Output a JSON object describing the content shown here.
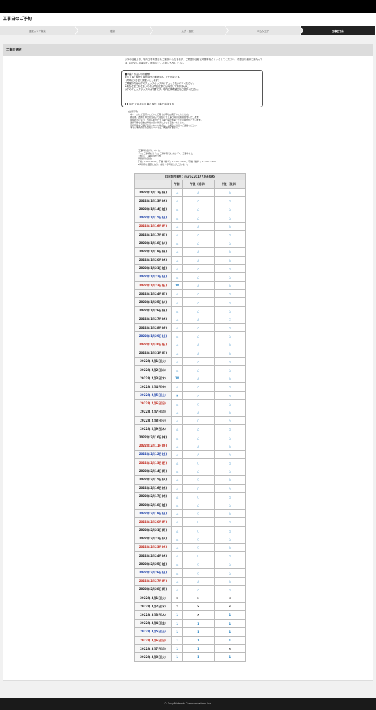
{
  "page_title": "工事日のご予約",
  "steps": [
    {
      "label": "選択カリア検索",
      "active": false
    },
    {
      "label": "確認",
      "active": false
    },
    {
      "label": "入力・選択",
      "active": false
    },
    {
      "label": "申込み完了",
      "active": false
    },
    {
      "label": "工事日予約",
      "active": true
    }
  ],
  "panel": {
    "title": "工事日選択",
    "intro": "以下の日程より、宅内工事希望日をご選択いただきます。ご希望の日程と時間帯をクリックしてください。希望日の選択にあたっては、以下の注意事項をご確認の上、お申し込みください。",
    "notebox": {
      "heading": "■戸建・お住いのお客様",
      "lines": [
        "宅内工事・屋外工事を同日で実施することも可能です。",
        "（同時に2日程を調整いたします）",
        "ご希望の方は以下のチェックボックスにチェックを入れてください。",
        "※集合住宅にお住まいの方は同日工事には対応しておりません。",
        "以下のチェックボックスは不要です。宅内工事希望日をご選択ください。"
      ],
      "checkbox_label": "同日での宅内工事・屋外工事を希望する"
    },
    "notes_title": "[注意事項]",
    "notes": [
      "・本ページにて選択いただいた日程でお申込は完了いたしません。",
      "・確定後、改めて弊社担当者より電話にて工事日時の最終確認をいたします。",
      "・申請状況により、お申込希望日で工事日程が確保できない場合がございます。",
      "・選択可能な日数は弊社の空き状況によって変動いたします。",
      "・選択可能な日程が表示されない場合は、お問合せ窓口へご連絡ください。",
      "・すでに予約済みの日程については、再選択不要です。"
    ],
    "legend_title": "[工事枠の表示について]",
    "legend_lines": [
      "「○」工事枠あり「△」工事枠残りわずか「×」工事枠なし",
      "「数字」工事枠の残り数",
      "[時間帯の目安]",
      "午前：9:00〜12:00、午後（前半）：12:00〜15:00、午後（後半）：15:00〜17:00",
      "※時間帯は目安となり、前後する可能性がございます。"
    ]
  },
  "calendar": {
    "id_label": "ISP契約番号：nuro220177366095",
    "columns": [
      "",
      "午前",
      "午後（前半）",
      "午後（後半）"
    ],
    "rows": [
      {
        "date": "2022年 1月12日(水)",
        "day": "weekday",
        "am": "△",
        "pm1": "△",
        "pm2": "△"
      },
      {
        "date": "2022年 1月13日(木)",
        "day": "weekday",
        "am": "△",
        "pm1": "△",
        "pm2": "△"
      },
      {
        "date": "2022年 1月14日(金)",
        "day": "weekday",
        "am": "△",
        "pm1": "△",
        "pm2": "△"
      },
      {
        "date": "2022年 1月15日(土)",
        "day": "sat",
        "am": "△",
        "pm1": "△",
        "pm2": "△"
      },
      {
        "date": "2022年 1月16日(日)",
        "day": "sun",
        "am": "△",
        "pm1": "△",
        "pm2": "△"
      },
      {
        "date": "2022年 1月17日(月)",
        "day": "weekday",
        "am": "△",
        "pm1": "△",
        "pm2": "△"
      },
      {
        "date": "2022年 1月18日(火)",
        "day": "weekday",
        "am": "△",
        "pm1": "△",
        "pm2": "△"
      },
      {
        "date": "2022年 1月19日(水)",
        "day": "weekday",
        "am": "△",
        "pm1": "△",
        "pm2": "△"
      },
      {
        "date": "2022年 1月20日(木)",
        "day": "weekday",
        "am": "△",
        "pm1": "△",
        "pm2": "△"
      },
      {
        "date": "2022年 1月21日(金)",
        "day": "weekday",
        "am": "△",
        "pm1": "△",
        "pm2": "△"
      },
      {
        "date": "2022年 1月22日(土)",
        "day": "sat",
        "am": "△",
        "pm1": "△",
        "pm2": "△"
      },
      {
        "date": "2022年 1月23日(日)",
        "day": "sun",
        "am": "10",
        "pm1": "△",
        "pm2": "△"
      },
      {
        "date": "2022年 1月24日(月)",
        "day": "weekday",
        "am": "△",
        "pm1": "△",
        "pm2": "△"
      },
      {
        "date": "2022年 1月25日(火)",
        "day": "weekday",
        "am": "△",
        "pm1": "△",
        "pm2": "△"
      },
      {
        "date": "2022年 1月26日(水)",
        "day": "weekday",
        "am": "△",
        "pm1": "△",
        "pm2": "△"
      },
      {
        "date": "2022年 1月27日(木)",
        "day": "weekday",
        "am": "△",
        "pm1": "△",
        "pm2": "○"
      },
      {
        "date": "2022年 1月28日(金)",
        "day": "weekday",
        "am": "△",
        "pm1": "△",
        "pm2": "△"
      },
      {
        "date": "2022年 1月29日(土)",
        "day": "sat",
        "am": "△",
        "pm1": "△",
        "pm2": "△"
      },
      {
        "date": "2022年 1月30日(日)",
        "day": "sun",
        "am": "△",
        "pm1": "△",
        "pm2": "△"
      },
      {
        "date": "2022年 1月31日(月)",
        "day": "weekday",
        "am": "△",
        "pm1": "△",
        "pm2": "△"
      },
      {
        "date": "2022年 2月1日(火)",
        "day": "weekday",
        "am": "△",
        "pm1": "△",
        "pm2": "△"
      },
      {
        "date": "2022年 2月2日(水)",
        "day": "weekday",
        "am": "△",
        "pm1": "△",
        "pm2": "△"
      },
      {
        "date": "2022年 2月3日(木)",
        "day": "weekday",
        "am": "10",
        "pm1": "△",
        "pm2": "△"
      },
      {
        "date": "2022年 2月4日(金)",
        "day": "weekday",
        "am": "△",
        "pm1": "△",
        "pm2": "△"
      },
      {
        "date": "2022年 2月5日(土)",
        "day": "sat",
        "am": "9",
        "pm1": "△",
        "pm2": "△"
      },
      {
        "date": "2022年 2月6日(日)",
        "day": "sun",
        "am": "△",
        "pm1": "○",
        "pm2": "△"
      },
      {
        "date": "2022年 2月7日(月)",
        "day": "weekday",
        "am": "△",
        "pm1": "△",
        "pm2": "△"
      },
      {
        "date": "2022年 2月8日(火)",
        "day": "weekday",
        "am": "△",
        "pm1": "○",
        "pm2": "△"
      },
      {
        "date": "2022年 2月9日(水)",
        "day": "weekday",
        "am": "△",
        "pm1": "△",
        "pm2": "△"
      },
      {
        "date": "2022年 2月10日(木)",
        "day": "weekday",
        "am": "△",
        "pm1": "△",
        "pm2": "△"
      },
      {
        "date": "2022年 2月11日(金)",
        "day": "sun",
        "am": "△",
        "pm1": "△",
        "pm2": "△"
      },
      {
        "date": "2022年 2月12日(土)",
        "day": "sat",
        "am": "△",
        "pm1": "△",
        "pm2": "△"
      },
      {
        "date": "2022年 2月13日(日)",
        "day": "sun",
        "am": "△",
        "pm1": "○",
        "pm2": "△"
      },
      {
        "date": "2022年 2月14日(月)",
        "day": "weekday",
        "am": "△",
        "pm1": "△",
        "pm2": "△"
      },
      {
        "date": "2022年 2月15日(火)",
        "day": "weekday",
        "am": "△",
        "pm1": "○",
        "pm2": "△"
      },
      {
        "date": "2022年 2月16日(水)",
        "day": "weekday",
        "am": "△",
        "pm1": "○",
        "pm2": "△"
      },
      {
        "date": "2022年 2月17日(木)",
        "day": "weekday",
        "am": "△",
        "pm1": "○",
        "pm2": "△"
      },
      {
        "date": "2022年 2月18日(金)",
        "day": "weekday",
        "am": "△",
        "pm1": "△",
        "pm2": "△"
      },
      {
        "date": "2022年 2月19日(土)",
        "day": "sat",
        "am": "△",
        "pm1": "○",
        "pm2": "△"
      },
      {
        "date": "2022年 2月20日(日)",
        "day": "sun",
        "am": "△",
        "pm1": "○",
        "pm2": "△"
      },
      {
        "date": "2022年 2月21日(月)",
        "day": "weekday",
        "am": "△",
        "pm1": "○",
        "pm2": "△"
      },
      {
        "date": "2022年 2月22日(火)",
        "day": "weekday",
        "am": "△",
        "pm1": "○",
        "pm2": "△"
      },
      {
        "date": "2022年 2月23日(水)",
        "day": "sun",
        "am": "△",
        "pm1": "○",
        "pm2": "△"
      },
      {
        "date": "2022年 2月24日(木)",
        "day": "weekday",
        "am": "△",
        "pm1": "○",
        "pm2": "△"
      },
      {
        "date": "2022年 2月25日(金)",
        "day": "weekday",
        "am": "△",
        "pm1": "○",
        "pm2": "△"
      },
      {
        "date": "2022年 2月26日(土)",
        "day": "sat",
        "am": "△",
        "pm1": "○",
        "pm2": "△"
      },
      {
        "date": "2022年 2月27日(日)",
        "day": "sun",
        "am": "△",
        "pm1": "△",
        "pm2": "△"
      },
      {
        "date": "2022年 2月28日(月)",
        "day": "weekday",
        "am": "△",
        "pm1": "△",
        "pm2": "△"
      },
      {
        "date": "2022年 3月1日(火)",
        "day": "weekday",
        "am": "×",
        "pm1": "×",
        "pm2": "×"
      },
      {
        "date": "2022年 3月2日(水)",
        "day": "weekday",
        "am": "×",
        "pm1": "×",
        "pm2": "×"
      },
      {
        "date": "2022年 3月3日(木)",
        "day": "weekday",
        "am": "1",
        "pm1": "×",
        "pm2": "1"
      },
      {
        "date": "2022年 3月4日(金)",
        "day": "weekday",
        "am": "1",
        "pm1": "1",
        "pm2": "1"
      },
      {
        "date": "2022年 3月5日(土)",
        "day": "sat",
        "am": "1",
        "pm1": "1",
        "pm2": "1"
      },
      {
        "date": "2022年 3月6日(日)",
        "day": "sun",
        "am": "1",
        "pm1": "1",
        "pm2": "1"
      },
      {
        "date": "2022年 3月7日(月)",
        "day": "weekday",
        "am": "1",
        "pm1": "1",
        "pm2": "×"
      },
      {
        "date": "2022年 3月8日(火)",
        "day": "weekday",
        "am": "1",
        "pm1": "1",
        "pm2": "1"
      }
    ]
  },
  "footer": "© Sony Network Communications Inc."
}
